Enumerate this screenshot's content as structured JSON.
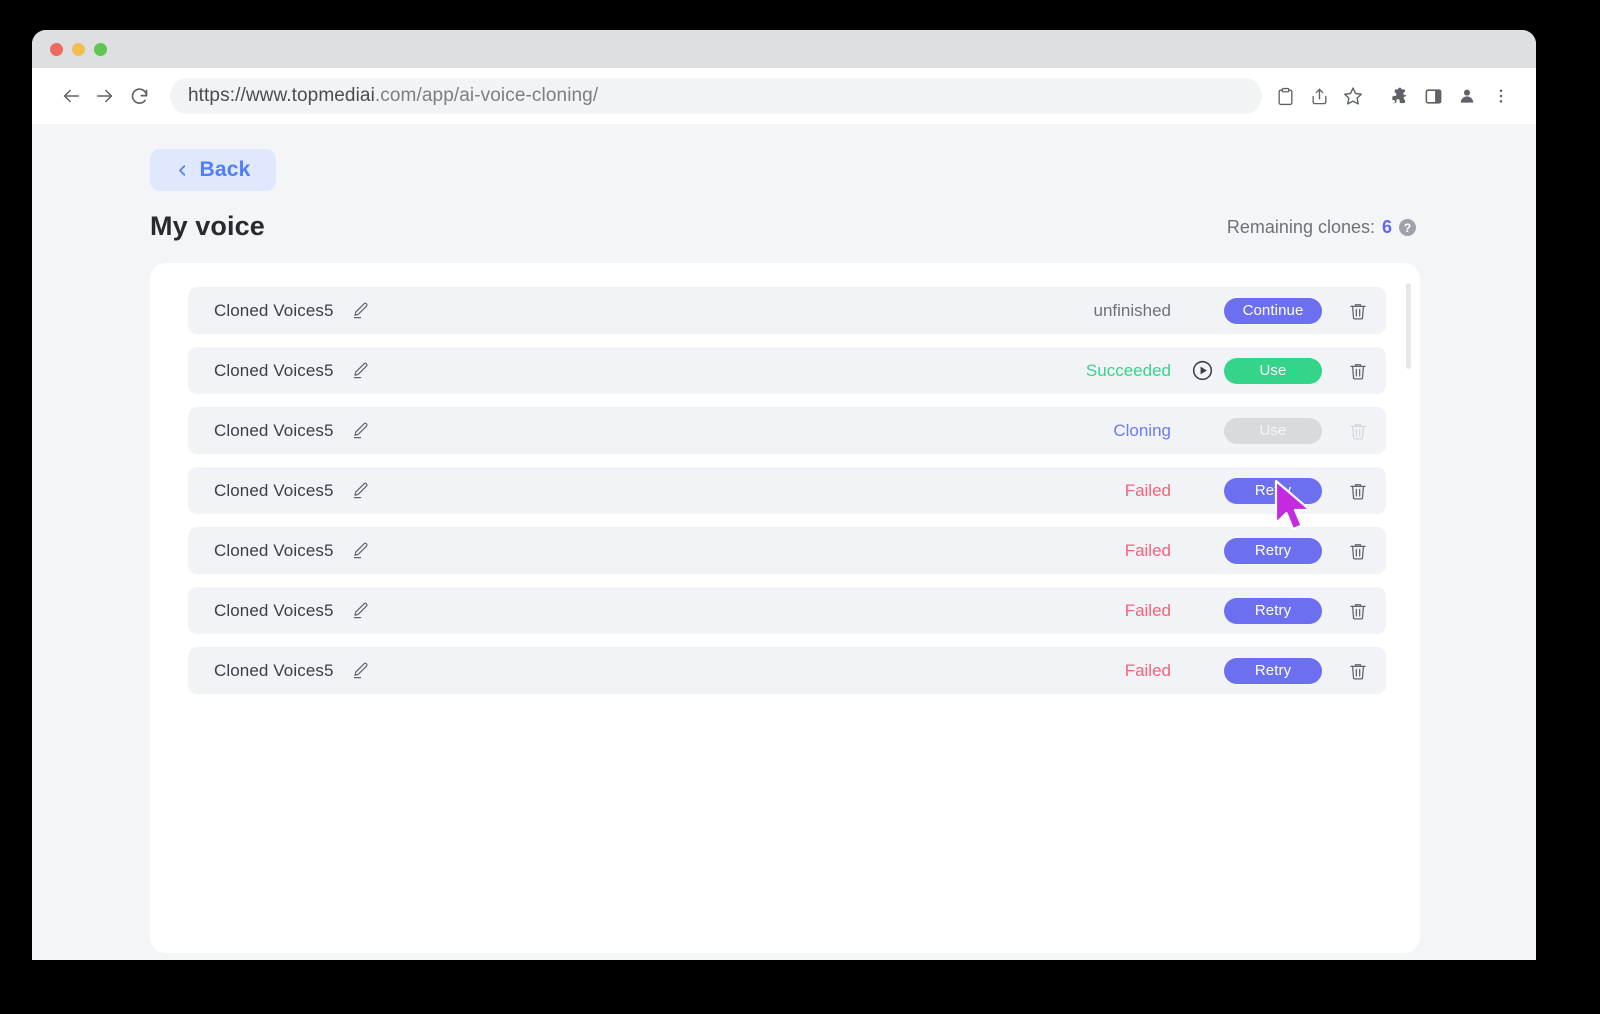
{
  "browser": {
    "url_full": "https://www.topmediai.com/app/ai-voice-cloning/",
    "url_prefix": "https://www.topmediai",
    "url_suffix": ".com/app/ai-voice-cloning/",
    "traffic_lights": [
      "close",
      "minimize",
      "maximize"
    ],
    "nav": {
      "back": "back-arrow-icon",
      "forward": "forward-arrow-icon",
      "reload": "reload-icon"
    },
    "toolbar_icons": [
      "clipboard-icon",
      "share-icon",
      "bookmark-star-icon",
      "extensions-puzzle-icon",
      "side-panel-icon",
      "profile-avatar-icon",
      "more-menu-icon"
    ]
  },
  "app": {
    "back_label": "Back",
    "back_icon": "chevron-left-icon",
    "page_title": "My voice",
    "remaining_label": "Remaining clones:",
    "remaining_count": "6",
    "help_glyph": "?",
    "colors": {
      "accent_purple": "#6c6ff0",
      "accent_blue": "#4f7dfb",
      "success_green": "#35d48b",
      "failed_red": "#f4637a",
      "cloning_blue": "#6c7cf5",
      "row_bg": "#f2f3f7",
      "page_bg": "#f4f5f7"
    },
    "rows": [
      {
        "name": "Cloned Voices5",
        "edit_icon": "pencil-edit-icon",
        "status": "unfinished",
        "status_class": "status-unfinished",
        "has_play": false,
        "action_label": "Continue",
        "action_class": "btn-primary",
        "action_disabled": false,
        "trash_icon": "trash-delete-icon",
        "trash_faded": false
      },
      {
        "name": "Cloned Voices5",
        "edit_icon": "pencil-edit-icon",
        "status": "Succeeded",
        "status_class": "status-succeeded",
        "has_play": true,
        "action_label": "Use",
        "action_class": "btn-success",
        "action_disabled": false,
        "trash_icon": "trash-delete-icon",
        "trash_faded": false
      },
      {
        "name": "Cloned Voices5",
        "edit_icon": "pencil-edit-icon",
        "status": "Cloning",
        "status_class": "status-cloning",
        "has_play": false,
        "action_label": "Use",
        "action_class": "btn-disabled",
        "action_disabled": true,
        "trash_icon": "trash-delete-icon",
        "trash_faded": true
      },
      {
        "name": "Cloned Voices5",
        "edit_icon": "pencil-edit-icon",
        "status": "Failed",
        "status_class": "status-failed",
        "has_play": false,
        "action_label": "Retry",
        "action_class": "btn-primary",
        "action_disabled": false,
        "trash_icon": "trash-delete-icon",
        "trash_faded": false
      },
      {
        "name": "Cloned Voices5",
        "edit_icon": "pencil-edit-icon",
        "status": "Failed",
        "status_class": "status-failed",
        "has_play": false,
        "action_label": "Retry",
        "action_class": "btn-primary",
        "action_disabled": false,
        "trash_icon": "trash-delete-icon",
        "trash_faded": false
      },
      {
        "name": "Cloned Voices5",
        "edit_icon": "pencil-edit-icon",
        "status": "Failed",
        "status_class": "status-failed",
        "has_play": false,
        "action_label": "Retry",
        "action_class": "btn-primary",
        "action_disabled": false,
        "trash_icon": "trash-delete-icon",
        "trash_faded": false
      },
      {
        "name": "Cloned Voices5",
        "edit_icon": "pencil-edit-icon",
        "status": "Failed",
        "status_class": "status-failed",
        "has_play": false,
        "action_label": "Retry",
        "action_class": "btn-primary",
        "action_disabled": false,
        "trash_icon": "trash-delete-icon",
        "trash_faded": false
      }
    ]
  },
  "cursor": {
    "icon": "mouse-pointer-arrow",
    "color": "#c52ae0"
  }
}
